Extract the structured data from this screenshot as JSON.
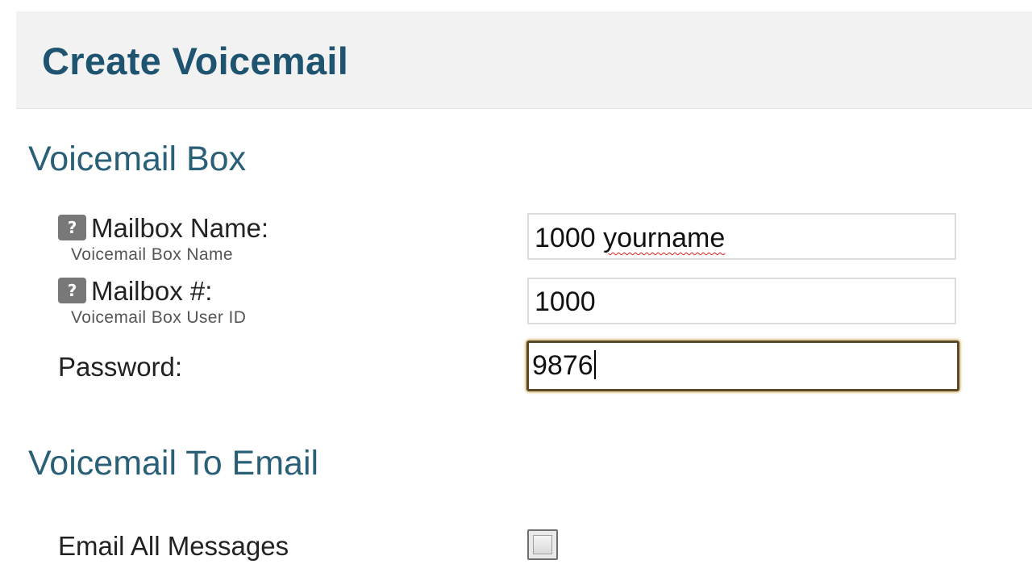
{
  "header": {
    "title": "Create Voicemail"
  },
  "sections": {
    "voicemail_box": {
      "heading": "Voicemail Box",
      "fields": {
        "mailbox_name": {
          "label": "Mailbox Name:",
          "sublabel": "Voicemail Box Name",
          "value": "1000 yourname",
          "value_number": "1000",
          "value_word": "yourname"
        },
        "mailbox_number": {
          "label": "Mailbox #:",
          "sublabel": "Voicemail Box User ID",
          "value": "1000"
        },
        "password": {
          "label": "Password:",
          "value": "9876"
        }
      }
    },
    "voicemail_to_email": {
      "heading": "Voicemail To Email",
      "fields": {
        "email_all_messages": {
          "label": "Email All Messages",
          "checked": false
        }
      }
    }
  },
  "icons": {
    "help": "?"
  },
  "colors": {
    "title": "#1e5470",
    "section_heading": "#2a5f78",
    "focus_border": "#5a4a2a",
    "help_icon_bg": "#787878"
  }
}
